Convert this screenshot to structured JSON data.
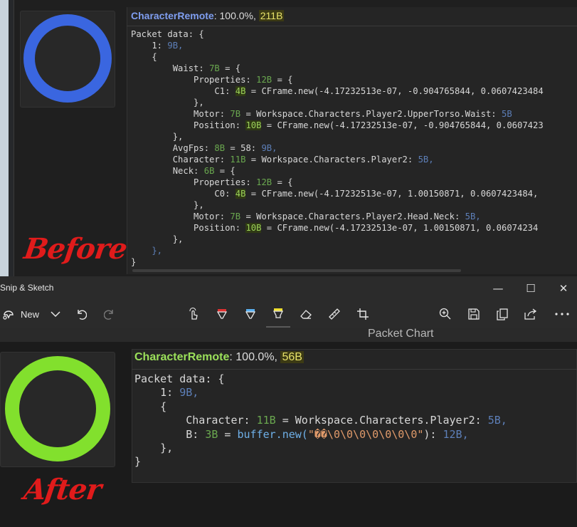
{
  "before": {
    "label": "Before",
    "ring_color": "#3a66e0",
    "header": {
      "name": "CharacterRemote",
      "pct": ": 100.0%, ",
      "size": "211B"
    },
    "code": {
      "l1": "Packet data: {",
      "l2_a": "    1: ",
      "l2_b": "9B,",
      "l3": "    {",
      "l4_a": "        Waist: ",
      "l4_b": "7B",
      "l4_c": " = {",
      "l5_a": "            Properties: ",
      "l5_b": "12B",
      "l5_c": " = {",
      "l6_a": "                C1: ",
      "l6_b": "4B",
      "l6_c": " = ",
      "l6_d": "CFrame.new(-4.17232513e-07, -0.904765844, 0.0607423484",
      "l7": "            },",
      "l8_a": "            Motor: ",
      "l8_b": "7B",
      "l8_c": " = Workspace.Characters.Player2.UpperTorso.Waist: ",
      "l8_d": "5B",
      "l9_a": "            Position: ",
      "l9_b": "10B",
      "l9_c": " = ",
      "l9_d": "CFrame.new(-4.17232513e-07, -0.904765844, 0.0607423",
      "l10": "        },",
      "l11_a": "        AvgFps: ",
      "l11_b": "8B",
      "l11_c": " = 58: ",
      "l11_d": "9B,",
      "l12_a": "        Character: ",
      "l12_b": "11B",
      "l12_c": " = Workspace.Characters.Player2: ",
      "l12_d": "5B,",
      "l13_a": "        Neck: ",
      "l13_b": "6B",
      "l13_c": " = {",
      "l14_a": "            Properties: ",
      "l14_b": "12B",
      "l14_c": " = {",
      "l15_a": "                C0: ",
      "l15_b": "4B",
      "l15_c": " = ",
      "l15_d": "CFrame.new(-4.17232513e-07, 1.00150871, 0.0607423484,",
      "l16": "            },",
      "l17_a": "            Motor: ",
      "l17_b": "7B",
      "l17_c": " = Workspace.Characters.Player2.Head.Neck: ",
      "l17_d": "5B,",
      "l18_a": "            Position: ",
      "l18_b": "10B",
      "l18_c": " = ",
      "l18_d": "CFrame.new(-4.17232513e-07, 1.00150871, 0.06074234",
      "l19": "        },",
      "l20": "    },",
      "l21": "}"
    }
  },
  "window": {
    "title": "Snip & Sketch",
    "minimize": "—",
    "maximize": "☐",
    "close": "✕",
    "new_label": "New",
    "chart_title": "Packet Chart"
  },
  "icons": [
    "new-snip-icon",
    "chevron-down-icon",
    "undo-icon",
    "redo-icon",
    "touch-writing-icon",
    "ballpoint-pen-icon",
    "pencil-icon",
    "highlighter-icon",
    "eraser-icon",
    "ruler-icon",
    "crop-icon",
    "zoom-in-icon",
    "save-icon",
    "copy-icon",
    "share-icon",
    "more-icon"
  ],
  "colors": {
    "pen_red": "#e03030",
    "pen_blue": "#5ab0f0",
    "highlighter_yellow": "#f0e030"
  },
  "after": {
    "label": "After",
    "ring_color": "#82e02d",
    "header": {
      "name": "CharacterRemote",
      "pct": ": 100.0%, ",
      "size": "56B"
    },
    "code": {
      "l1": "Packet data: {",
      "l2_a": "    1: ",
      "l2_b": "9B,",
      "l3": "    {",
      "l4_a": "        Character: ",
      "l4_b": "11B",
      "l4_c": " = Workspace.Characters.Player2: ",
      "l4_d": "5B,",
      "l5_a": "        B: ",
      "l5_b": "3B",
      "l5_c": " = ",
      "l5_d": "buffer.new(",
      "l5_e": "\"��\\0\\0\\0\\0\\0\\0\\0\"",
      "l5_f": "): ",
      "l5_g": "12B,",
      "l6": "    },",
      "l7": "}"
    }
  }
}
